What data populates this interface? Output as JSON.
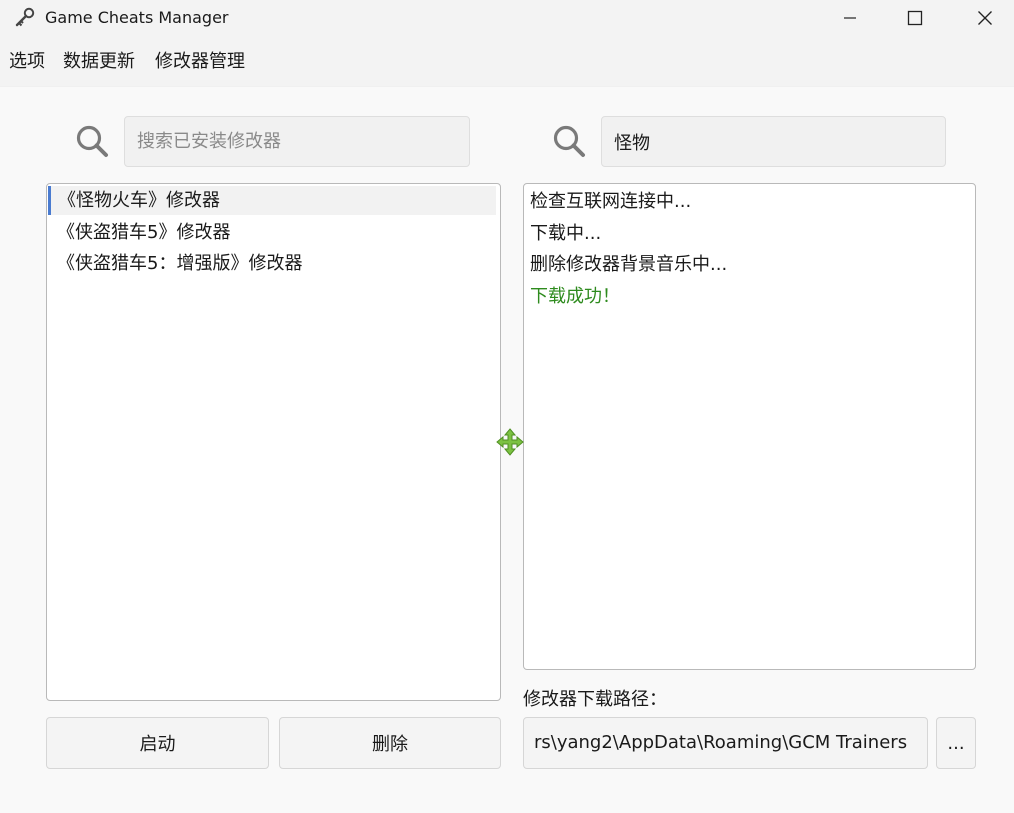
{
  "window": {
    "title": "Game Cheats Manager",
    "controls": {
      "minimize": "minimize",
      "maximize": "maximize",
      "close": "close"
    }
  },
  "menu": {
    "items": [
      "选项",
      "数据更新",
      "修改器管理"
    ]
  },
  "left_panel": {
    "search_placeholder": "搜索已安装修改器",
    "search_value": "",
    "trainers": [
      "《怪物火车》修改器",
      "《侠盗猎车5》修改器",
      "《侠盗猎车5：增强版》修改器"
    ],
    "selected_index": 0,
    "launch_button": "启动",
    "delete_button": "删除"
  },
  "right_panel": {
    "search_value": "怪物",
    "log": [
      {
        "text": "检查互联网连接中...",
        "status": "normal"
      },
      {
        "text": "下载中...",
        "status": "normal"
      },
      {
        "text": "删除修改器背景音乐中...",
        "status": "normal"
      },
      {
        "text": "下载成功！",
        "status": "success"
      }
    ],
    "path_label": "修改器下载路径：",
    "path_value": "rs\\yang2\\AppData\\Roaming\\GCM Trainers",
    "browse_button": "..."
  },
  "colors": {
    "success": "#2e8b1e",
    "icon_gray": "#7a7a7a",
    "selection_accent": "#4a7bd0",
    "move_icon": "#7cc242"
  },
  "icons": {
    "app": "key-icon",
    "search": "search-icon",
    "cursor": "move-cursor-icon"
  }
}
